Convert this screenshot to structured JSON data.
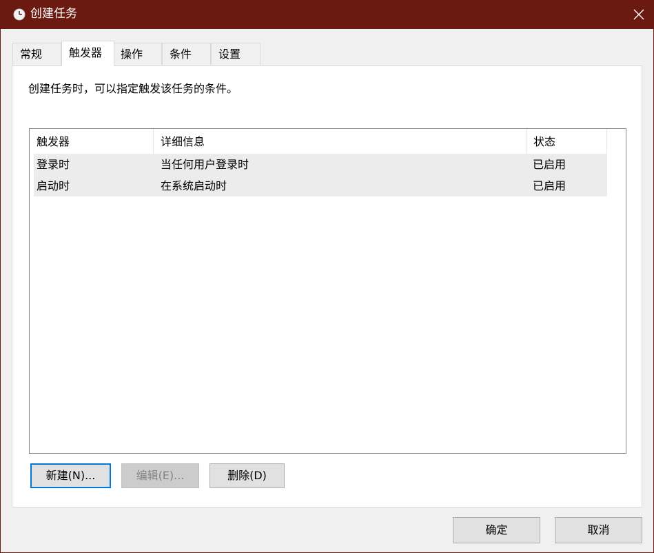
{
  "window": {
    "title": "创建任务",
    "icon": "clock-icon",
    "close": "close-icon"
  },
  "tabs": [
    {
      "label": "常规",
      "active": false
    },
    {
      "label": "触发器",
      "active": true
    },
    {
      "label": "操作",
      "active": false
    },
    {
      "label": "条件",
      "active": false
    },
    {
      "label": "设置",
      "active": false
    }
  ],
  "triggers_tab": {
    "description": "创建任务时，可以指定触发该任务的条件。",
    "columns": [
      "触发器",
      "详细信息",
      "状态"
    ],
    "rows": [
      {
        "trigger": "登录时",
        "details": "当任何用户登录时",
        "status": "已启用"
      },
      {
        "trigger": "启动时",
        "details": "在系统启动时",
        "status": "已启用"
      }
    ],
    "buttons": {
      "new": "新建(N)...",
      "edit": "编辑(E)...",
      "delete": "删除(D)"
    }
  },
  "footer": {
    "ok": "确定",
    "cancel": "取消"
  },
  "colors": {
    "titlebar": "#6b1a12",
    "focus_border": "#0078d7",
    "row_bg": "#ececec"
  }
}
